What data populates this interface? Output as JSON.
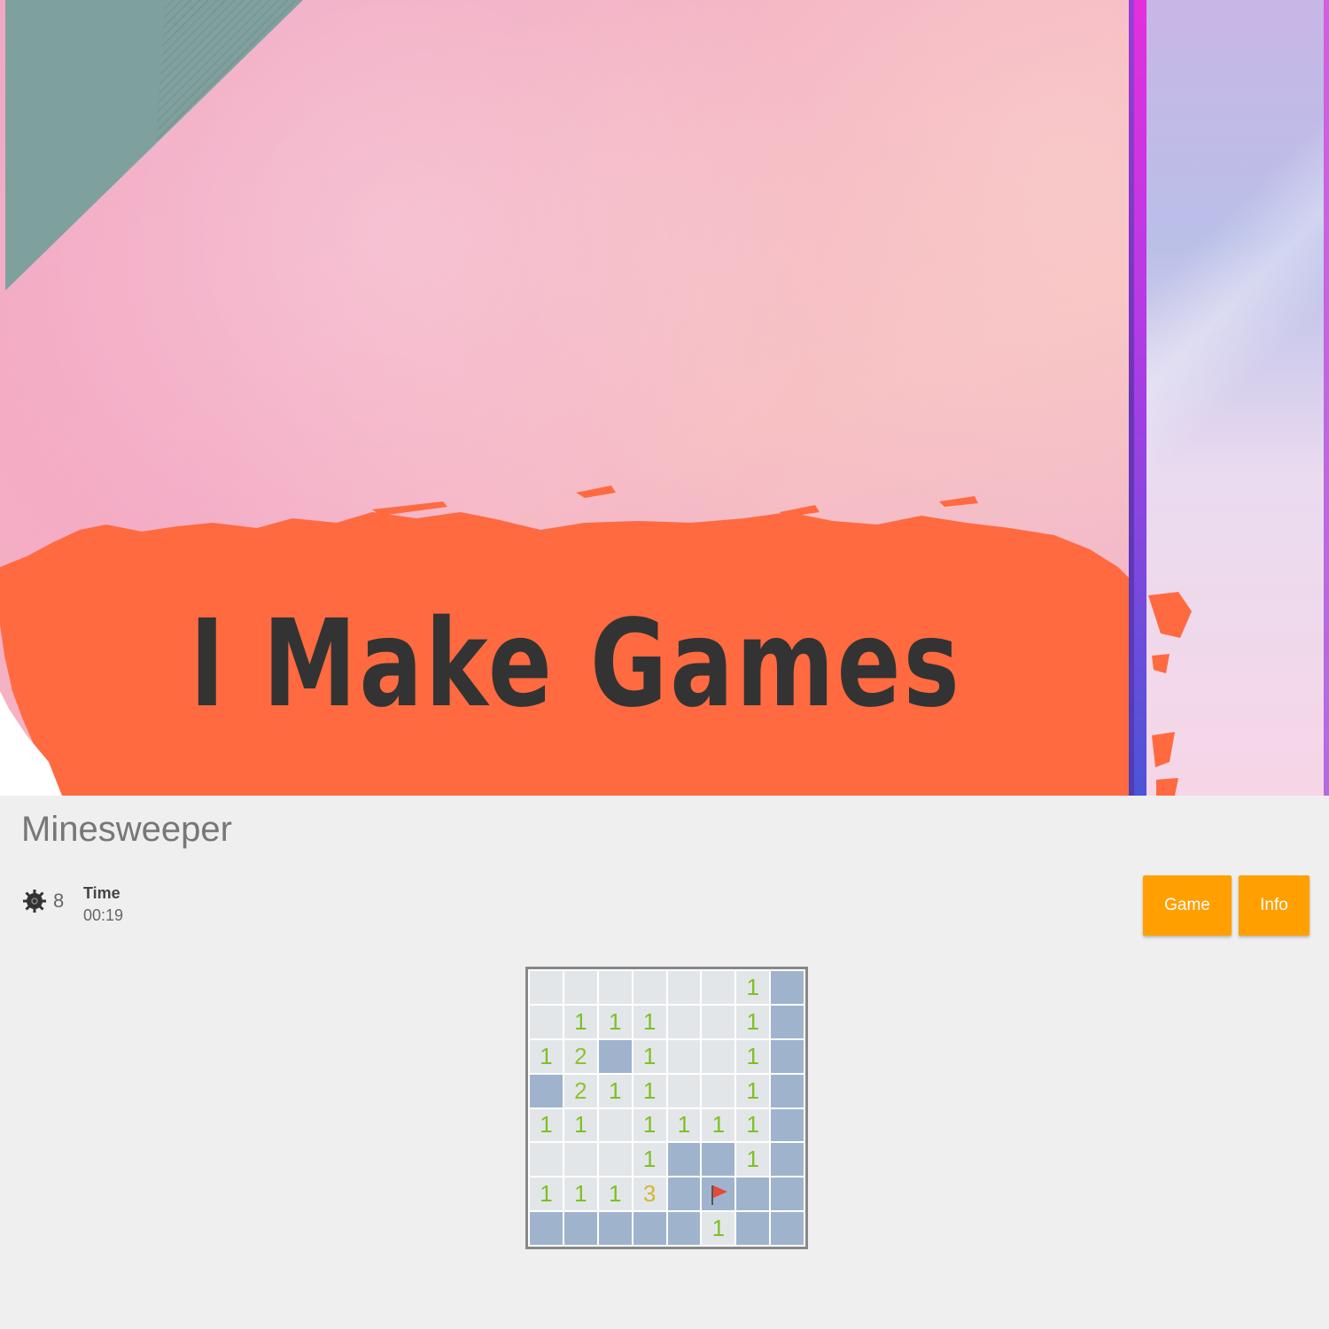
{
  "banner": {
    "title": "I Make Games"
  },
  "page": {
    "title": "Minesweeper"
  },
  "status": {
    "mine_icon": "mine-icon",
    "mines_remaining": "8",
    "time_label": "Time",
    "time_value": "00:19"
  },
  "buttons": {
    "game_label": "Game",
    "info_label": "Info"
  },
  "colors": {
    "accent_button": "#ffa000",
    "banner_stroke": "#ff6a40",
    "closed_cell": "#9fb4cc",
    "open_cell": "#e3e6e9",
    "number_1": "#7cc124",
    "number_2": "#8fc134",
    "number_3": "#d2b829",
    "flag": "#e5493a"
  },
  "board": {
    "rows": 8,
    "cols": 8,
    "legend": "O = open empty, C = closed, F = flagged, digit = open with count",
    "cells": [
      [
        "O",
        "O",
        "O",
        "O",
        "O",
        "O",
        "1",
        "C"
      ],
      [
        "O",
        "1",
        "1",
        "1",
        "O",
        "O",
        "1",
        "C"
      ],
      [
        "1",
        "2",
        "C",
        "1",
        "O",
        "O",
        "1",
        "C"
      ],
      [
        "C",
        "2",
        "1",
        "1",
        "O",
        "O",
        "1",
        "C"
      ],
      [
        "1",
        "1",
        "O",
        "1",
        "1",
        "1",
        "1",
        "C"
      ],
      [
        "O",
        "O",
        "O",
        "1",
        "C",
        "C",
        "1",
        "C"
      ],
      [
        "1",
        "1",
        "1",
        "3",
        "C",
        "F",
        "C",
        "C"
      ],
      [
        "C",
        "C",
        "C",
        "C",
        "C",
        "1",
        "C",
        "C"
      ]
    ]
  }
}
